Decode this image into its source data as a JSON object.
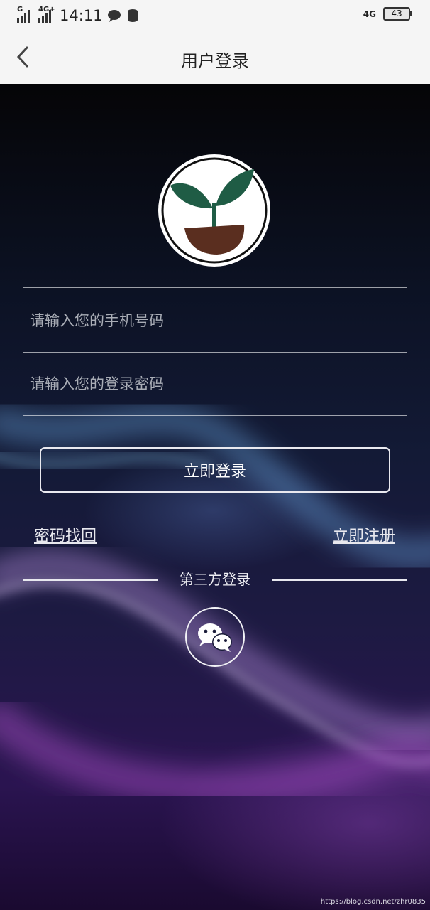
{
  "status_bar": {
    "signal1_label": "G",
    "signal2_label": "4G+",
    "time": "14:11",
    "right_network": "4G",
    "battery": "43"
  },
  "nav": {
    "title": "用户登录",
    "back_icon": "chevron-left-icon"
  },
  "form": {
    "phone_placeholder": "请输入您的手机号码",
    "phone_value": "",
    "password_placeholder": "请输入您的登录密码",
    "password_value": "",
    "login_label": "立即登录",
    "forgot_label": "密码找回",
    "register_label": "立即注册"
  },
  "third_party": {
    "title": "第三方登录",
    "wechat_icon": "wechat-icon"
  },
  "watermark": "https://blog.csdn.net/zhr0835",
  "colors": {
    "leaf": "#1f5c45",
    "pot": "#5a2e1f",
    "border": "#e9e9ef"
  }
}
